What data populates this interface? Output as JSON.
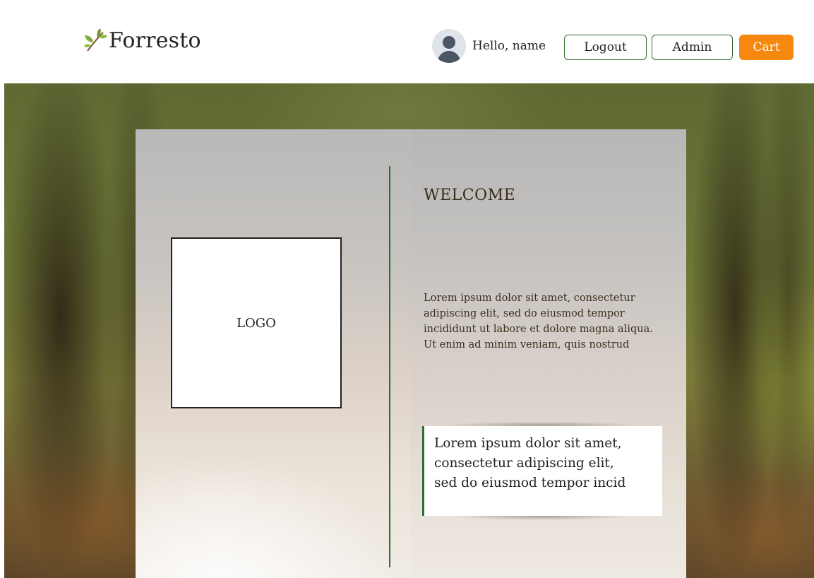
{
  "header": {
    "brand": "Forresto",
    "brand_icon": "leaf-sprig-icon",
    "greeting": "Hello, name",
    "avatar_icon": "user-avatar-icon",
    "buttons": {
      "logout": "Logout",
      "admin": "Admin",
      "cart": "Cart"
    }
  },
  "main": {
    "logo_placeholder": "LOGO",
    "welcome": "WELCOME",
    "paragraph": "Lorem ipsum dolor sit amet, consectetur adipiscing elit, sed do eiusmod tempor incididunt ut labore et dolore magna aliqua. Ut enim ad minim veniam, quis nostrud",
    "quote_lines": [
      "Lorem ipsum dolor sit amet,",
      "consectetur adipiscing elit,",
      "sed do eiusmod tempor incid"
    ]
  },
  "colors": {
    "accent_green": "#2f6b2f",
    "cart_orange": "#f7880f"
  }
}
